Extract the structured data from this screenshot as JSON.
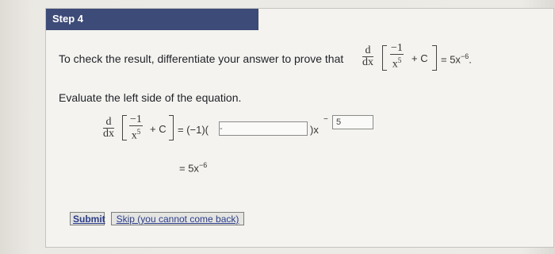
{
  "step": {
    "title": "Step 4"
  },
  "instruction": {
    "text": "To check the result, differentiate your answer to prove that",
    "d": "d",
    "dx": "dx",
    "frac_num": "−1",
    "frac_den_base": "x",
    "frac_den_exp": "5",
    "plus_c": "+ C",
    "rhs": "= 5x",
    "rhs_exp": "−6",
    "period": "."
  },
  "evaluate": {
    "text": "Evaluate the left side of the equation.",
    "d": "d",
    "dx": "dx",
    "frac_num": "−1",
    "frac_den_base": "x",
    "frac_den_exp": "5",
    "plus_c": "+ C",
    "eq_part": "= (−1)(",
    "answer_value": "-",
    "close_part": ")x",
    "exp_prefix": "−",
    "exp_value": "5",
    "result": "= 5x",
    "result_exp": "−6"
  },
  "buttons": {
    "submit": "Submit",
    "skip": "Skip (you cannot come back)"
  }
}
